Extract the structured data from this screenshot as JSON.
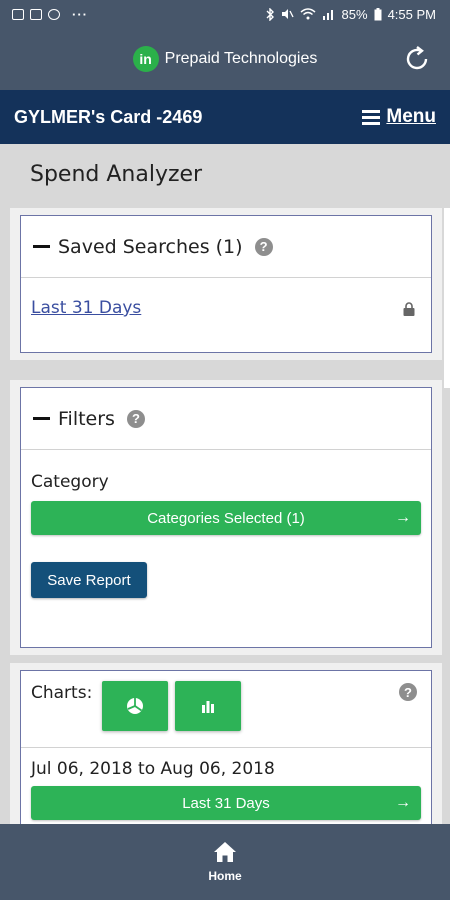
{
  "status_bar": {
    "battery": "85%",
    "time": "4:55 PM"
  },
  "header": {
    "brand_logo": "in",
    "brand_name": "Prepaid Technologies",
    "refresh_icon": "refresh-icon"
  },
  "card_bar": {
    "card_title": "GYLMER's Card -2469",
    "menu_label": "Menu"
  },
  "page": {
    "title": "Spend Analyzer"
  },
  "saved_searches": {
    "heading": "Saved Searches (1)",
    "help": "?",
    "items": [
      {
        "label": "Last 31 Days",
        "icon": "lock-icon"
      }
    ]
  },
  "filters": {
    "heading": "Filters",
    "help": "?",
    "category_label": "Category",
    "categories_button": "Categories Selected (1)",
    "save_button": "Save Report"
  },
  "charts": {
    "label": "Charts:",
    "help": "?",
    "buttons": [
      {
        "icon": "pie-chart-icon"
      },
      {
        "icon": "bar-chart-icon"
      }
    ],
    "date_range": "Jul 06, 2018 to Aug 06, 2018",
    "period_button": "Last 31 Days"
  },
  "bottom_nav": {
    "home_label": "Home",
    "home_icon": "home-icon"
  },
  "colors": {
    "header_bg": "#47566a",
    "card_bar_bg": "#14325a",
    "accent_green": "#2db357",
    "save_blue": "#14507a",
    "link_blue": "#3a4ea0"
  }
}
